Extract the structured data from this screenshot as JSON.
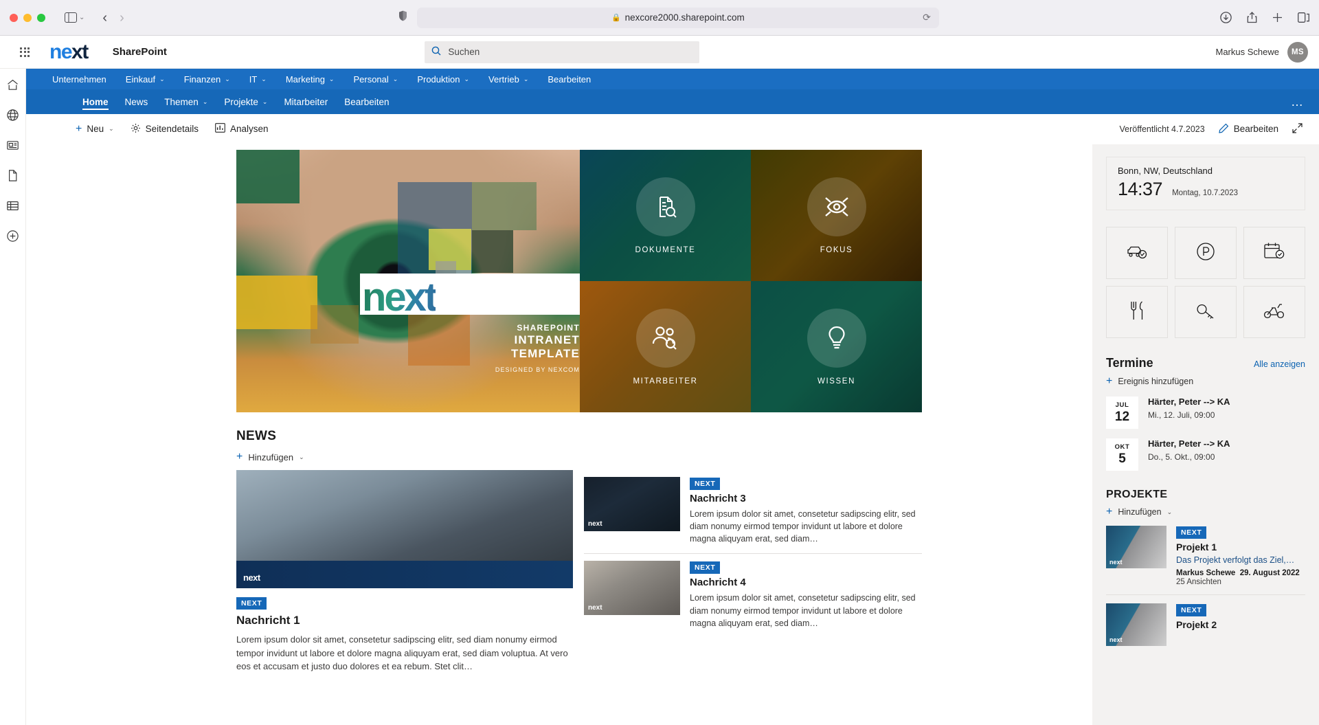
{
  "browser": {
    "url": "nexcore2000.sharepoint.com",
    "lock_icon": "lock-icon",
    "shield_icon": "shield-icon",
    "reload_icon": "reload-icon",
    "back_icon": "chevron-left-icon",
    "forward_icon": "chevron-right-icon",
    "sidebar_icon": "sidebar-toggle-icon",
    "download_icon": "download-icon",
    "share_icon": "share-icon",
    "newtab_icon": "plus-icon",
    "tabs_icon": "tab-overview-icon"
  },
  "suite": {
    "waffle_icon": "app-launcher-icon",
    "brand_part1": "ne",
    "brand_part2": "xt",
    "title": "SharePoint",
    "search_placeholder": "Suchen",
    "search_icon": "search-icon",
    "user_name": "Markus Schewe",
    "user_initials": "MS"
  },
  "rail": {
    "items": [
      {
        "name": "home-icon"
      },
      {
        "name": "globe-icon"
      },
      {
        "name": "news-icon"
      },
      {
        "name": "files-icon"
      },
      {
        "name": "lists-icon"
      },
      {
        "name": "create-icon"
      }
    ]
  },
  "hub_nav": {
    "items": [
      {
        "label": "Unternehmen",
        "chevron": false
      },
      {
        "label": "Einkauf",
        "chevron": true
      },
      {
        "label": "Finanzen",
        "chevron": true
      },
      {
        "label": "IT",
        "chevron": true
      },
      {
        "label": "Marketing",
        "chevron": true
      },
      {
        "label": "Personal",
        "chevron": true
      },
      {
        "label": "Produktion",
        "chevron": true
      },
      {
        "label": "Vertrieb",
        "chevron": true
      },
      {
        "label": "Bearbeiten",
        "chevron": false
      }
    ]
  },
  "site_nav": {
    "items": [
      {
        "label": "Home",
        "chevron": false,
        "active": true
      },
      {
        "label": "News",
        "chevron": false,
        "active": false
      },
      {
        "label": "Themen",
        "chevron": true,
        "active": false
      },
      {
        "label": "Projekte",
        "chevron": true,
        "active": false
      },
      {
        "label": "Mitarbeiter",
        "chevron": false,
        "active": false
      },
      {
        "label": "Bearbeiten",
        "chevron": false,
        "active": false
      }
    ],
    "ellipsis": "…"
  },
  "command_bar": {
    "new_label": "Neu",
    "page_details_label": "Seitendetails",
    "analytics_label": "Analysen",
    "published_text": "Veröffentlicht 4.7.2023",
    "edit_label": "Bearbeiten",
    "new_icon": "plus-icon",
    "gear_icon": "gear-icon",
    "chart_icon": "analytics-icon",
    "pencil_icon": "pencil-icon",
    "expand_icon": "expand-icon"
  },
  "hero": {
    "logo_text": "next",
    "line1": "SHAREPOINT",
    "line2": "INTRANET TEMPLATE",
    "line3": "DESIGNED BY NEXCOM",
    "tiles": [
      {
        "label": "DOKUMENTE",
        "icon": "document-search-icon",
        "theme": "t-dok"
      },
      {
        "label": "FOKUS",
        "icon": "focus-eye-icon",
        "theme": "t-fok"
      },
      {
        "label": "MITARBEITER",
        "icon": "people-search-icon",
        "theme": "t-mit"
      },
      {
        "label": "WISSEN",
        "icon": "lightbulb-icon",
        "theme": "t-wis"
      }
    ]
  },
  "news": {
    "title": "NEWS",
    "add_label": "Hinzufügen",
    "featured": {
      "tag": "NEXT",
      "title": "Nachricht 1",
      "body": "Lorem ipsum dolor sit amet, consetetur sadipscing elitr, sed diam nonumy eirmod tempor invidunt ut labore et dolore magna aliquyam erat, sed diam voluptua. At vero eos et accusam et justo duo dolores et ea rebum. Stet clit…",
      "watermark": "next"
    },
    "items": [
      {
        "tag": "NEXT",
        "title": "Nachricht 3",
        "body": "Lorem ipsum dolor sit amet, consetetur sadipscing elitr, sed diam nonumy eirmod tempor invidunt ut labore et dolore magna aliquyam erat, sed diam…",
        "watermark": "next"
      },
      {
        "tag": "NEXT",
        "title": "Nachricht 4",
        "body": "Lorem ipsum dolor sit amet, consetetur sadipscing elitr, sed diam nonumy eirmod tempor invidunt ut labore et dolore magna aliquyam erat, sed diam…",
        "watermark": "next"
      }
    ]
  },
  "weather": {
    "location": "Bonn, NW, Deutschland",
    "time": "14:37",
    "date": "Montag, 10.7.2023"
  },
  "quick_actions": {
    "tiles": [
      {
        "icon": "car-check-icon"
      },
      {
        "icon": "parking-icon"
      },
      {
        "icon": "calendar-check-icon"
      },
      {
        "icon": "cutlery-icon"
      },
      {
        "icon": "key-icon"
      },
      {
        "icon": "scooter-icon"
      }
    ]
  },
  "events": {
    "title": "Termine",
    "view_all": "Alle anzeigen",
    "add_label": "Ereignis hinzufügen",
    "items": [
      {
        "month": "JUL",
        "day": "12",
        "title": "Härter, Peter --> KA",
        "when": "Mi., 12. Juli, 09:00"
      },
      {
        "month": "OKT",
        "day": "5",
        "title": "Härter, Peter --> KA",
        "when": "Do., 5. Okt., 09:00"
      }
    ]
  },
  "projects": {
    "title": "PROJEKTE",
    "add_label": "Hinzufügen",
    "items": [
      {
        "tag": "NEXT",
        "title": "Projekt 1",
        "desc": "Das Projekt verfolgt das Ziel,…",
        "author": "Markus Schewe",
        "date": "29. August 2022",
        "views": "25 Ansichten",
        "watermark": "next"
      },
      {
        "tag": "NEXT",
        "title": "Projekt 2",
        "desc": "",
        "author": "",
        "date": "",
        "views": "",
        "watermark": "next"
      }
    ]
  },
  "colors": {
    "hub_blue": "#1b6ec2",
    "site_blue": "#1668b8",
    "accent_link": "#0b62b1",
    "panel_bg": "#f3f2f1"
  }
}
